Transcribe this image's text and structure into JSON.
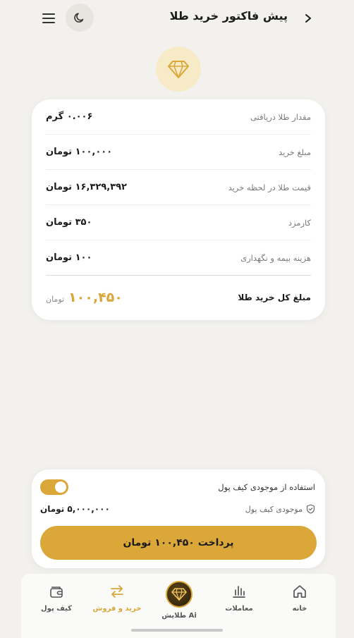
{
  "header": {
    "title": "پیش فاکتور خرید طلا",
    "back_icon": "chevron-right-icon",
    "theme_icon": "moon-icon",
    "menu_icon": "hamburger-menu-icon"
  },
  "badge": {
    "icon": "diamond-icon"
  },
  "invoice": {
    "rows": [
      {
        "label": "مقدار طلا دریافتی",
        "value": "۰.۰۰۶ گرم"
      },
      {
        "label": "مبلغ خرید",
        "value": "۱۰۰,۰۰۰ تومان"
      },
      {
        "label": "قیمت طلا در لحظه خرید",
        "value": "۱۶,۳۲۹,۳۹۲ تومان"
      },
      {
        "label": "کارمزد",
        "value": "۳۵۰ تومان"
      },
      {
        "label": "هزینه بیمه و نگهداری",
        "value": "۱۰۰ تومان"
      }
    ],
    "total_label": "مبلغ کل خرید طلا",
    "total_value": "۱۰۰,۴۵۰",
    "total_unit": "تومان"
  },
  "payment": {
    "use_wallet_label": "استفاده از موجودی کیف پول",
    "use_wallet_on": true,
    "balance_label": "موجودی کیف پول",
    "balance_value": "۵,۰۰۰,۰۰۰ تومان",
    "pay_button_label": "پرداخت ۱۰۰,۴۵۰ تومان"
  },
  "nav": {
    "items": [
      {
        "label": "خانه",
        "icon": "home-icon"
      },
      {
        "label": "معاملات",
        "icon": "bar-chart-icon"
      },
      {
        "label": "طلایش Ai",
        "icon": "ai-diamond-icon"
      },
      {
        "label": "خرید و فروش",
        "icon": "swap-arrows-icon",
        "active": true
      },
      {
        "label": "کیف پول",
        "icon": "wallet-icon"
      }
    ]
  },
  "colors": {
    "accent": "#dba739",
    "background": "#f2f1ed",
    "badge_bg": "#f7ebc7"
  }
}
